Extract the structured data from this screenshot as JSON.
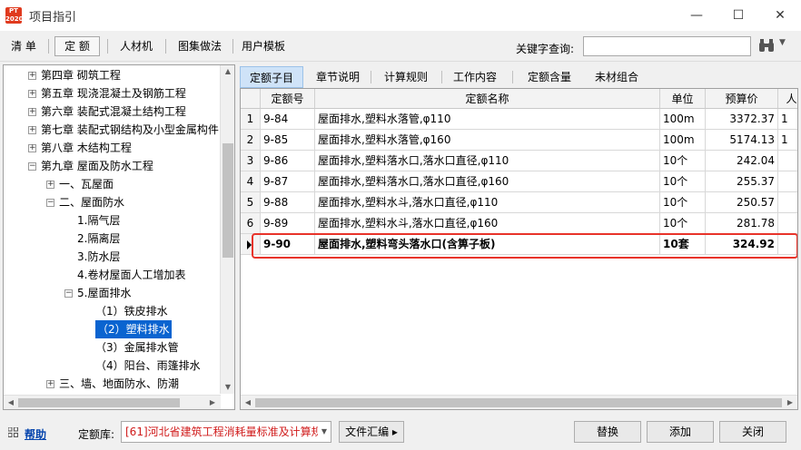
{
  "window": {
    "title": "项目指引",
    "logo_text": "PT 2020",
    "minimize": "—",
    "maximize": "☐",
    "close": "✕"
  },
  "toolbar": {
    "items": [
      "清 单",
      "定 额",
      "人材机",
      "图集做法",
      "用户模板"
    ],
    "active": "定 额",
    "keyword_label": "关键字查询:",
    "keyword_value": "",
    "search_dropdown": "▼"
  },
  "tree": {
    "items": [
      {
        "toggle": "+",
        "label": "第四章 砌筑工程"
      },
      {
        "toggle": "+",
        "label": "第五章 现浇混凝土及钢筋工程"
      },
      {
        "toggle": "+",
        "label": "第六章 装配式混凝土结构工程"
      },
      {
        "toggle": "+",
        "label": "第七章 装配式钢结构及小型金属构件"
      },
      {
        "toggle": "+",
        "label": "第八章 木结构工程"
      },
      {
        "toggle": "−",
        "label": "第九章 屋面及防水工程"
      },
      {
        "toggle": "+",
        "label": "一、瓦屋面"
      },
      {
        "toggle": "−",
        "label": "二、屋面防水"
      },
      {
        "toggle": "",
        "label": "1.隔气层"
      },
      {
        "toggle": "",
        "label": "2.隔离层"
      },
      {
        "toggle": "",
        "label": "3.防水层"
      },
      {
        "toggle": "",
        "label": "4.卷材屋面人工增加表"
      },
      {
        "toggle": "−",
        "label": "5.屋面排水"
      },
      {
        "toggle": "",
        "label": "（1）铁皮排水"
      },
      {
        "toggle": "",
        "label": "（2）塑料排水"
      },
      {
        "toggle": "",
        "label": "（3）金属排水管"
      },
      {
        "toggle": "",
        "label": "（4）阳台、雨篷排水"
      },
      {
        "toggle": "+",
        "label": "三、墙、地面防水、防潮"
      }
    ],
    "selected": "（2）塑料排水"
  },
  "tabs": [
    "定额子目",
    "章节说明",
    "计算规则",
    "工作内容",
    "定额含量",
    "未材组合"
  ],
  "active_tab": "定额子目",
  "table": {
    "columns": [
      "",
      "定额号",
      "定额名称",
      "单位",
      "预算价",
      "人"
    ],
    "rows": [
      {
        "no": "1",
        "code": "9-84",
        "name": "屋面排水,塑料水落管,φ110",
        "unit": "100m",
        "price": "3372.37",
        "extra": "1"
      },
      {
        "no": "2",
        "code": "9-85",
        "name": "屋面排水,塑料水落管,φ160",
        "unit": "100m",
        "price": "5174.13",
        "extra": "1"
      },
      {
        "no": "3",
        "code": "9-86",
        "name": "屋面排水,塑料落水口,落水口直径,φ110",
        "unit": "10个",
        "price": "242.04",
        "extra": ""
      },
      {
        "no": "4",
        "code": "9-87",
        "name": "屋面排水,塑料落水口,落水口直径,φ160",
        "unit": "10个",
        "price": "255.37",
        "extra": ""
      },
      {
        "no": "5",
        "code": "9-88",
        "name": "屋面排水,塑料水斗,落水口直径,φ110",
        "unit": "10个",
        "price": "250.57",
        "extra": ""
      },
      {
        "no": "6",
        "code": "9-89",
        "name": "屋面排水,塑料水斗,落水口直径,φ160",
        "unit": "10个",
        "price": "281.78",
        "extra": ""
      },
      {
        "no": "",
        "code": "9-90",
        "name": "屋面排水,塑料弯头落水口(含箅子板)",
        "unit": "10套",
        "price": "324.92",
        "extra": ""
      }
    ],
    "highlight_color": "#e8332a"
  },
  "footer": {
    "help": "帮助",
    "library_label": "定额库:",
    "library_value": "[61]河北省建筑工程消耗量标准及计算规",
    "library_dropdown": "▼",
    "file_button": "文件汇编 ▸",
    "replace_button": "替换",
    "add_button": "添加",
    "close_button": "关闭"
  },
  "colors": {
    "selection": "#0a64d0",
    "tab_active": "#cfe3f8",
    "library_text": "#d01b1b",
    "link": "#0645ad"
  }
}
